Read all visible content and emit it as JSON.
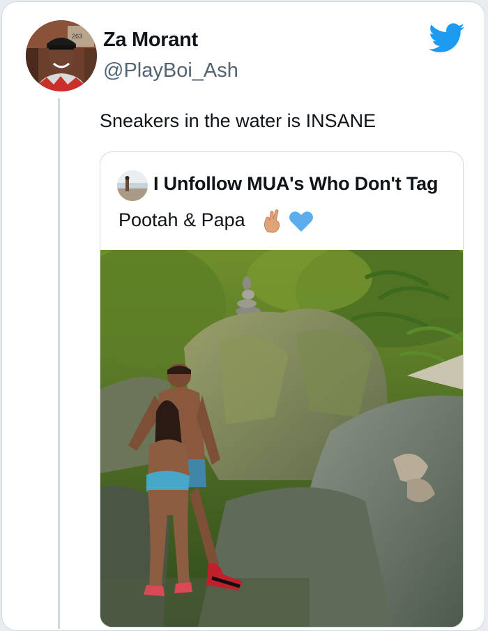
{
  "tweet": {
    "author_name": "Za Morant",
    "author_handle": "@PlayBoi_Ash",
    "text": "Sneakers in the water is INSANE",
    "avatar_sign_text": "263"
  },
  "quoted_tweet": {
    "author_name": "I Unfollow MUA's Who Don't Tag",
    "text": "Pootah & Papa",
    "emoji": [
      "crossed-fingers-emoji",
      "blue-heart-emoji"
    ]
  },
  "icons": {
    "platform": "twitter-bird-icon"
  },
  "colors": {
    "twitter_blue": "#1d9bf0",
    "heart_blue": "#5dadec",
    "handle_gray": "#536471",
    "border": "#cfd9de"
  }
}
